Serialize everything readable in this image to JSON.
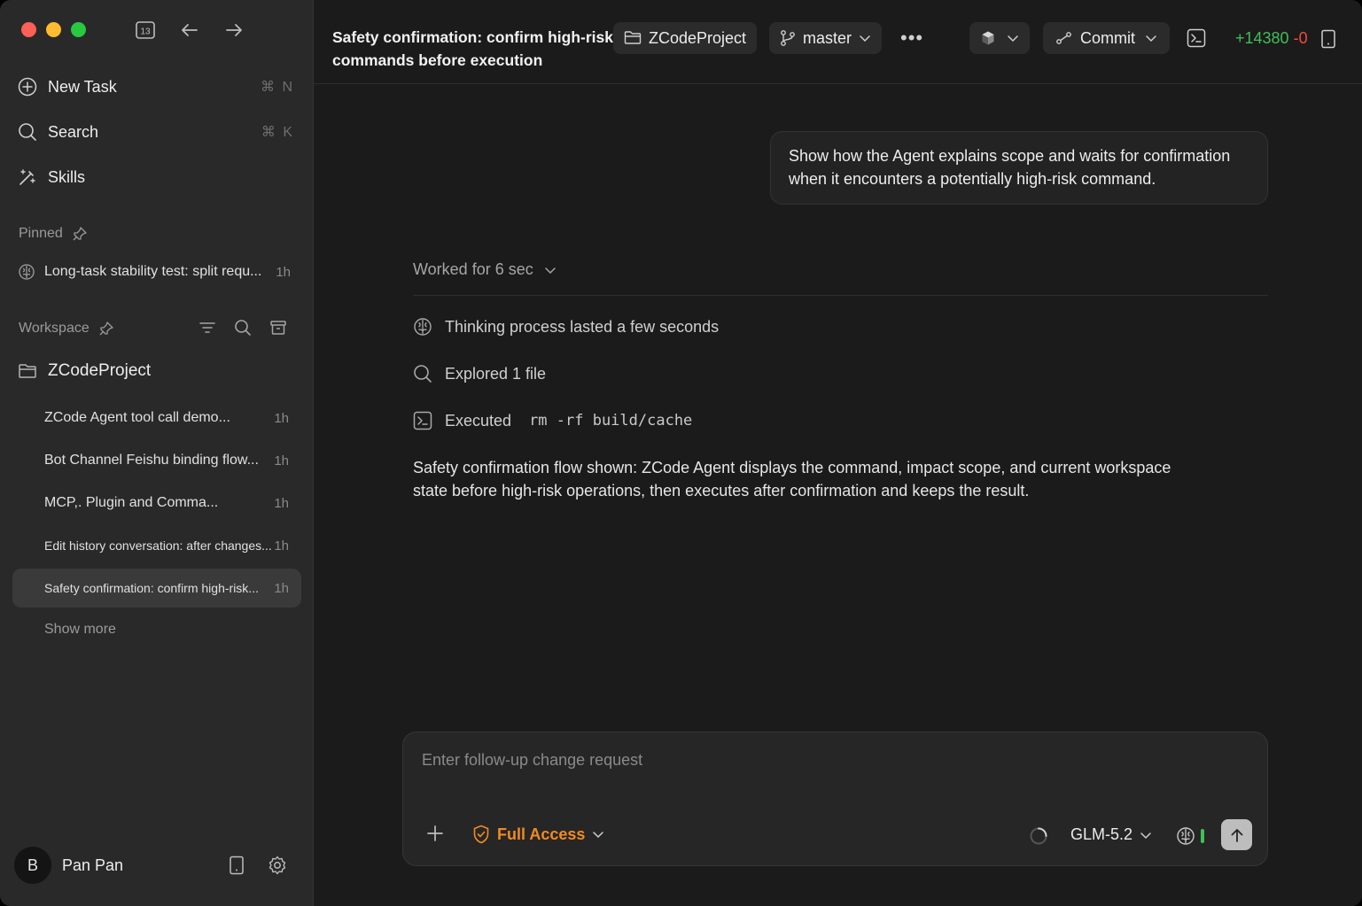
{
  "sidebar": {
    "counter_badge": "13",
    "nav": {
      "new_task": {
        "label": "New Task",
        "shortcut": "⌘ N"
      },
      "search": {
        "label": "Search",
        "shortcut": "⌘ K"
      },
      "skills": {
        "label": "Skills"
      }
    },
    "pinned_label": "Pinned",
    "pinned_items": [
      {
        "title": "Long-task stability test: split requ...",
        "time": "1h"
      }
    ],
    "workspace_label": "Workspace",
    "project_name": "ZCodeProject",
    "tasks": [
      {
        "title": "ZCode Agent tool call demo...",
        "time": "1h"
      },
      {
        "title": "Bot Channel Feishu binding flow...",
        "time": "1h"
      },
      {
        "title": "MCP,. Plugin and Comma...",
        "time": "1h"
      },
      {
        "title": "Edit history conversation: after changes...",
        "time": "1h"
      },
      {
        "title": "Safety confirmation: confirm high-risk...",
        "time": "1h"
      }
    ],
    "show_more": "Show more",
    "user": {
      "initial": "B",
      "name": "Pan Pan"
    }
  },
  "header": {
    "title": "Safety confirmation: confirm high-risk commands before execution",
    "project": "ZCodeProject",
    "branch": "master",
    "commit_label": "Commit",
    "diff_added": "+14380",
    "diff_removed": "-0"
  },
  "conversation": {
    "user_message": "Show how the Agent explains scope and waits for confirmation when it encounters a potentially high-risk command.",
    "worked_for": "Worked for 6 sec",
    "steps": {
      "thinking": "Thinking process lasted a few seconds",
      "explored": "Explored 1 file",
      "executed_label": "Executed",
      "executed_command": "rm -rf build/cache"
    },
    "summary": "Safety confirmation flow shown: ZCode Agent displays the command, impact scope, and current workspace state before high-risk operations, then executes after confirmation and keeps the result."
  },
  "composer": {
    "placeholder": "Enter follow-up change request",
    "access_mode": "Full Access",
    "model": "GLM-5.2"
  },
  "colors": {
    "accent_orange": "#f08a24",
    "added_green": "#3fbf55",
    "removed_red": "#ef4b40"
  }
}
